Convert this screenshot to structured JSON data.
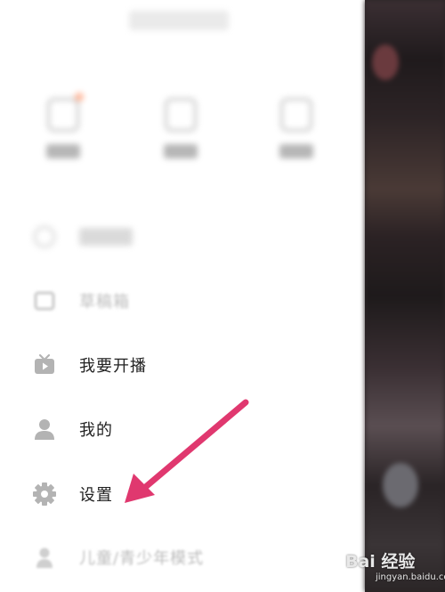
{
  "menu": {
    "drafts_label": "草稿箱",
    "live_label": "我要开播",
    "mine_label": "我的",
    "settings_label": "设置",
    "kids_label": "儿童/青少年模式"
  },
  "watermark": {
    "brand": "Bai 经验",
    "url": "jingyan.baidu.com"
  },
  "colors": {
    "arrow": "#e0386f",
    "icon_gray": "#b3b3b3",
    "text": "#222222"
  }
}
